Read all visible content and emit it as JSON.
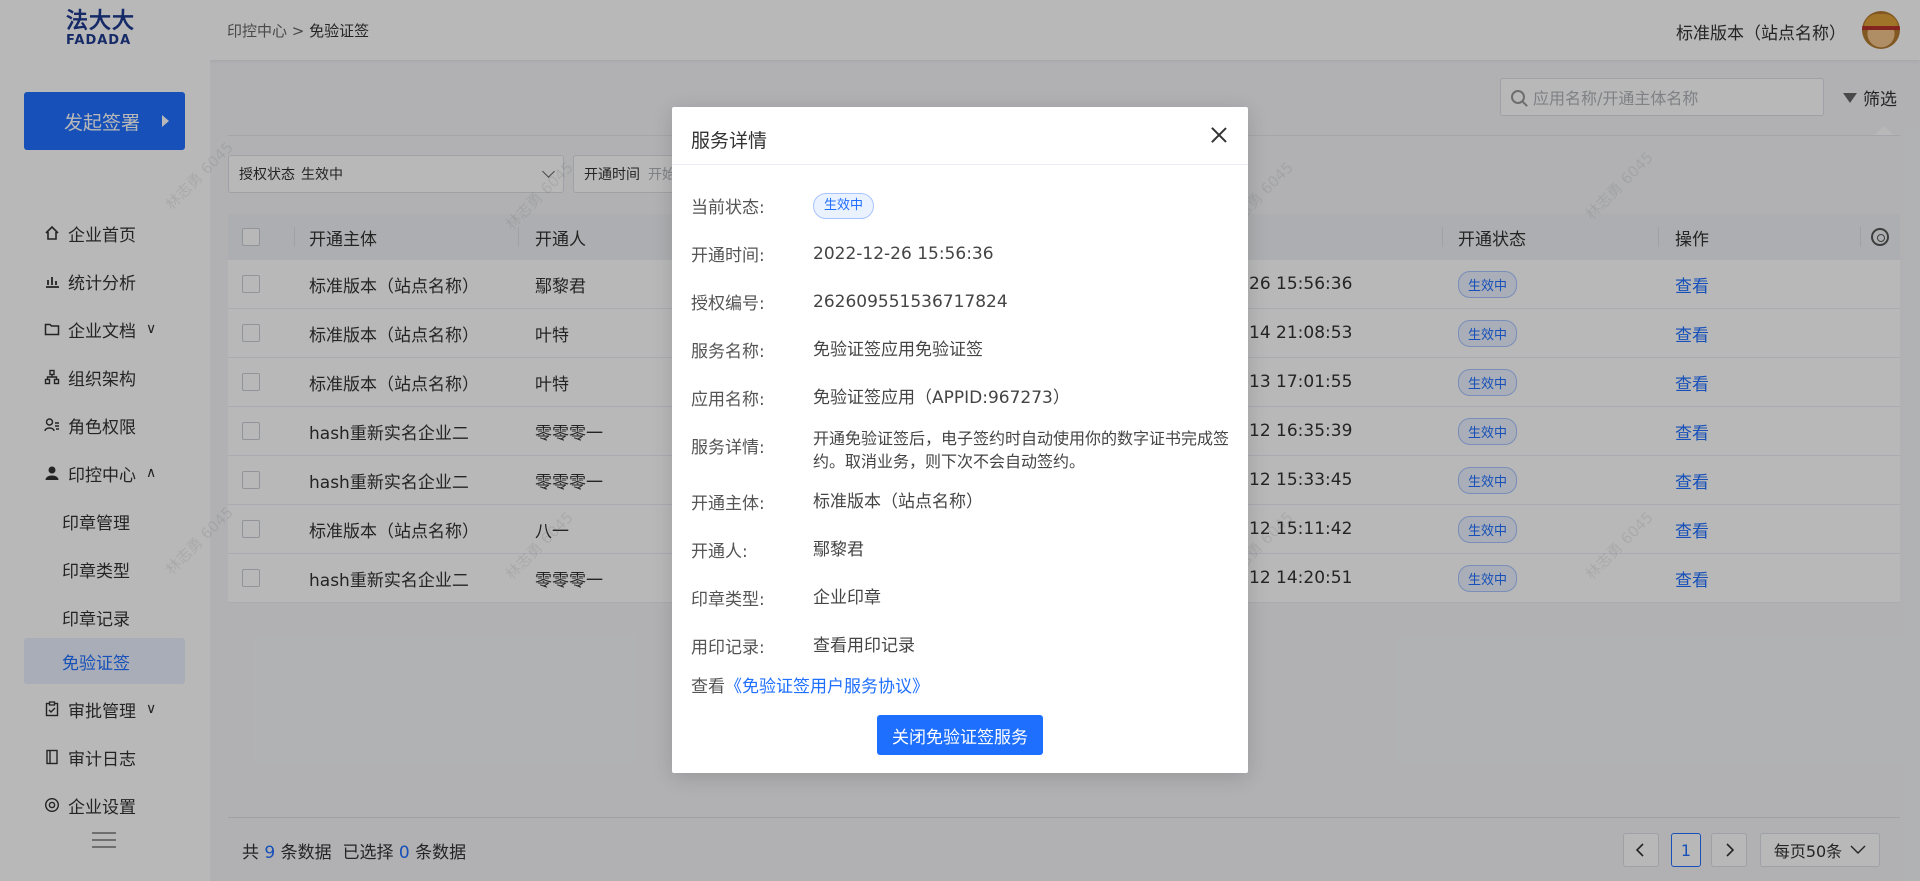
{
  "header": {
    "logo_cn": "法大大",
    "logo_en": "FADADA",
    "breadcrumb_parent": "印控中心",
    "breadcrumb_sep": ">",
    "breadcrumb_current": "免验证签",
    "site_name": "标准版本（站点名称）"
  },
  "sidebar": {
    "start_button": "发起签署",
    "items": [
      {
        "label": "企业首页",
        "icon": "home-icon"
      },
      {
        "label": "统计分析",
        "icon": "bar-chart-icon"
      },
      {
        "label": "企业文档",
        "icon": "folder-icon",
        "caret": "∨"
      },
      {
        "label": "组织架构",
        "icon": "org-chart-icon"
      },
      {
        "label": "角色权限",
        "icon": "user-role-icon"
      },
      {
        "label": "印控中心",
        "icon": "user-icon",
        "caret": "∧"
      },
      {
        "label": "印章管理"
      },
      {
        "label": "印章类型"
      },
      {
        "label": "印章记录"
      },
      {
        "label": "免验证签"
      },
      {
        "label": "审批管理",
        "icon": "clipboard-icon",
        "caret": "∨"
      },
      {
        "label": "审计日志",
        "icon": "book-icon"
      },
      {
        "label": "企业设置",
        "icon": "settings-icon"
      }
    ]
  },
  "toolbar": {
    "search_placeholder": "应用名称/开通主体名称",
    "filter_label": "筛选"
  },
  "filters": {
    "auth_status_label": "授权状态",
    "auth_status_value": "生效中",
    "open_time_label": "开通时间",
    "open_time_placeholder": "开始"
  },
  "table": {
    "headers": [
      "开通主体",
      "开通人",
      "开通状态",
      "操作"
    ],
    "rows": [
      {
        "subject": "标准版本（站点名称）",
        "person": "鄢黎君",
        "time": "26 15:56:36",
        "status": "生效中",
        "action": "查看"
      },
      {
        "subject": "标准版本（站点名称）",
        "person": "叶特",
        "time": "14 21:08:53",
        "status": "生效中",
        "action": "查看"
      },
      {
        "subject": "标准版本（站点名称）",
        "person": "叶特",
        "time": "13 17:01:55",
        "status": "生效中",
        "action": "查看"
      },
      {
        "subject": "hash重新实名企业二",
        "person": "零零零一",
        "time": "12 16:35:39",
        "status": "生效中",
        "action": "查看"
      },
      {
        "subject": "hash重新实名企业二",
        "person": "零零零一",
        "time": "12 15:33:45",
        "status": "生效中",
        "action": "查看"
      },
      {
        "subject": "标准版本（站点名称）",
        "person": "八一",
        "time": "12 15:11:42",
        "status": "生效中",
        "action": "查看"
      },
      {
        "subject": "hash重新实名企业二",
        "person": "零零零一",
        "time": "12 14:20:51",
        "status": "生效中",
        "action": "查看"
      }
    ]
  },
  "footer": {
    "total_prefix": "共",
    "total": "9",
    "total_suffix": "条数据",
    "selected_prefix": "已选择",
    "selected": "0",
    "selected_suffix": "条数据",
    "current_page": "1",
    "page_size": "每页50条"
  },
  "watermark": "林志勇 6045",
  "modal": {
    "title": "服务详情",
    "fields": [
      {
        "label": "当前状态:",
        "value": "生效中"
      },
      {
        "label": "开通时间:",
        "value": "2022-12-26 15:56:36"
      },
      {
        "label": "授权编号:",
        "value": "262609551536717824"
      },
      {
        "label": "服务名称:",
        "value": "免验证签应用免验证签"
      },
      {
        "label": "应用名称:",
        "value": "免验证签应用（APPID:967273）"
      },
      {
        "label": "服务详情:",
        "value": "开通免验证签后，电子签约时自动使用你的数字证书完成签约。取消业务，则下次不会自动签约。"
      },
      {
        "label": "开通主体:",
        "value": "标准版本（站点名称）"
      },
      {
        "label": "开通人:",
        "value": "鄢黎君"
      },
      {
        "label": "印章类型:",
        "value": "企业印章"
      },
      {
        "label": "用印记录:",
        "value": "查看用印记录"
      }
    ],
    "agreement_prefix": "查看",
    "agreement_link": "《免验证签用户服务协议》",
    "close_service_button": "关闭免验证签服务"
  },
  "colors": {
    "primary": "#1f6fff",
    "logo": "#1f3b8f",
    "overlay": "rgba(0,0,0,0.28)"
  }
}
